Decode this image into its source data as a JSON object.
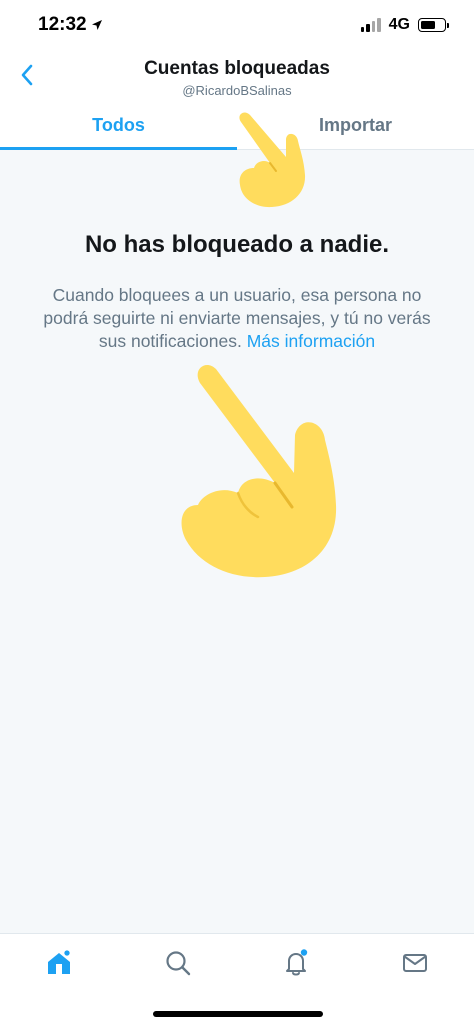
{
  "status_bar": {
    "time": "12:32",
    "network": "4G"
  },
  "header": {
    "title": "Cuentas bloqueadas",
    "subtitle": "@RicardoBSalinas"
  },
  "tabs": [
    {
      "label": "Todos",
      "active": true
    },
    {
      "label": "Importar",
      "active": false
    }
  ],
  "empty_state": {
    "title": "No has bloqueado a nadie.",
    "body": "Cuando bloquees a un usuario, esa persona no podrá seguirte ni enviarte mensajes, y tú no verás sus notificaciones. ",
    "link": "Más información"
  },
  "icons": {
    "back": "chevron-left-icon",
    "home": "home-icon",
    "search": "search-icon",
    "notifications": "bell-icon",
    "messages": "mail-icon",
    "overlay": "pointing-hand-emoji"
  },
  "colors": {
    "accent": "#1da1f2",
    "secondary_text": "#657786",
    "background": "#f5f8fa",
    "emoji": "#ffdc5d"
  }
}
